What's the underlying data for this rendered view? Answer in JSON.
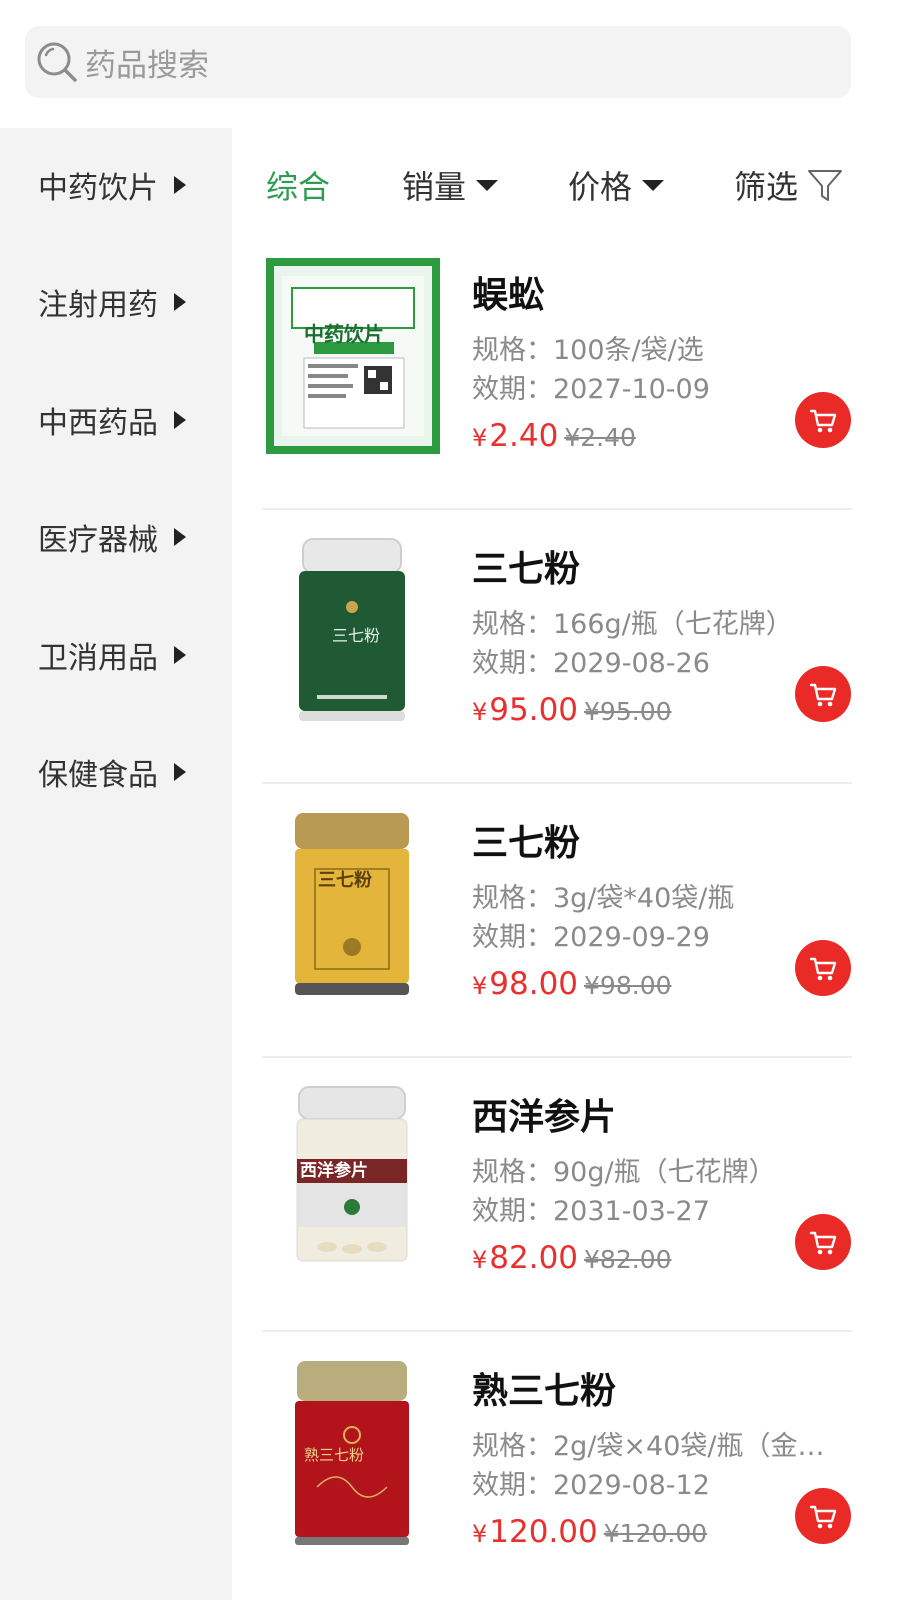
{
  "search": {
    "placeholder": "药品搜索"
  },
  "sidebar": {
    "items": [
      {
        "label": "中药饮片"
      },
      {
        "label": "注射用药"
      },
      {
        "label": "中西药品"
      },
      {
        "label": "医疗器械"
      },
      {
        "label": "卫消用品"
      },
      {
        "label": "保健食品"
      }
    ]
  },
  "sort": {
    "comprehensive": "综合",
    "sales": "销量",
    "price": "价格",
    "filter": "筛选"
  },
  "colors": {
    "accent": "#2e9c52",
    "price": "#e8302f",
    "cart": "#ea2a27"
  },
  "products": [
    {
      "name": "蜈蚣",
      "spec": "规格：100条/袋/选",
      "expiry": "效期：2027-10-09",
      "currency": "¥",
      "price": "2.40",
      "old_price": "¥2.40",
      "package_label": "中药饮片"
    },
    {
      "name": "三七粉",
      "spec": "规格：166g/瓶（七花牌）",
      "expiry": "效期：2029-08-26",
      "currency": "¥",
      "price": "95.00",
      "old_price": "¥95.00",
      "package_label": "三七粉"
    },
    {
      "name": "三七粉",
      "spec": "规格：3g/袋*40袋/瓶",
      "expiry": "效期：2029-09-29",
      "currency": "¥",
      "price": "98.00",
      "old_price": "¥98.00",
      "package_label": "三七粉"
    },
    {
      "name": "西洋参片",
      "spec": "规格：90g/瓶（七花牌）",
      "expiry": "效期：2031-03-27",
      "currency": "¥",
      "price": "82.00",
      "old_price": "¥82.00",
      "package_label": "西洋参片"
    },
    {
      "name": "熟三七粉",
      "spec": "规格：2g/袋×40袋/瓶（金…",
      "expiry": "效期：2029-08-12",
      "currency": "¥",
      "price": "120.00",
      "old_price": "¥120.00",
      "package_label": "熟三七粉"
    }
  ]
}
